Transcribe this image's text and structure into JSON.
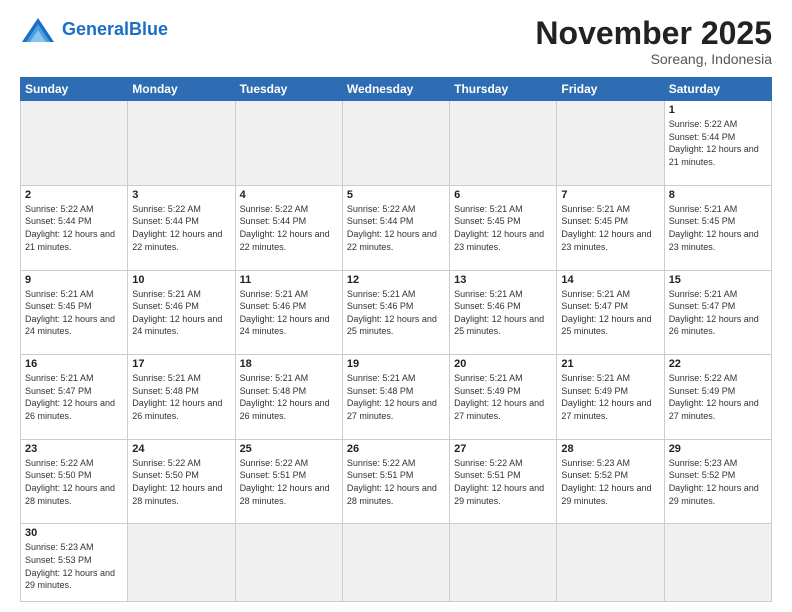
{
  "logo": {
    "general": "General",
    "blue": "Blue"
  },
  "header": {
    "month": "November 2025",
    "location": "Soreang, Indonesia"
  },
  "days_of_week": [
    "Sunday",
    "Monday",
    "Tuesday",
    "Wednesday",
    "Thursday",
    "Friday",
    "Saturday"
  ],
  "weeks": [
    [
      {
        "day": "",
        "info": ""
      },
      {
        "day": "",
        "info": ""
      },
      {
        "day": "",
        "info": ""
      },
      {
        "day": "",
        "info": ""
      },
      {
        "day": "",
        "info": ""
      },
      {
        "day": "",
        "info": ""
      },
      {
        "day": "1",
        "info": "Sunrise: 5:22 AM\nSunset: 5:44 PM\nDaylight: 12 hours and 21 minutes."
      }
    ],
    [
      {
        "day": "2",
        "info": "Sunrise: 5:22 AM\nSunset: 5:44 PM\nDaylight: 12 hours and 21 minutes."
      },
      {
        "day": "3",
        "info": "Sunrise: 5:22 AM\nSunset: 5:44 PM\nDaylight: 12 hours and 22 minutes."
      },
      {
        "day": "4",
        "info": "Sunrise: 5:22 AM\nSunset: 5:44 PM\nDaylight: 12 hours and 22 minutes."
      },
      {
        "day": "5",
        "info": "Sunrise: 5:22 AM\nSunset: 5:44 PM\nDaylight: 12 hours and 22 minutes."
      },
      {
        "day": "6",
        "info": "Sunrise: 5:21 AM\nSunset: 5:45 PM\nDaylight: 12 hours and 23 minutes."
      },
      {
        "day": "7",
        "info": "Sunrise: 5:21 AM\nSunset: 5:45 PM\nDaylight: 12 hours and 23 minutes."
      },
      {
        "day": "8",
        "info": "Sunrise: 5:21 AM\nSunset: 5:45 PM\nDaylight: 12 hours and 23 minutes."
      }
    ],
    [
      {
        "day": "9",
        "info": "Sunrise: 5:21 AM\nSunset: 5:45 PM\nDaylight: 12 hours and 24 minutes."
      },
      {
        "day": "10",
        "info": "Sunrise: 5:21 AM\nSunset: 5:46 PM\nDaylight: 12 hours and 24 minutes."
      },
      {
        "day": "11",
        "info": "Sunrise: 5:21 AM\nSunset: 5:46 PM\nDaylight: 12 hours and 24 minutes."
      },
      {
        "day": "12",
        "info": "Sunrise: 5:21 AM\nSunset: 5:46 PM\nDaylight: 12 hours and 25 minutes."
      },
      {
        "day": "13",
        "info": "Sunrise: 5:21 AM\nSunset: 5:46 PM\nDaylight: 12 hours and 25 minutes."
      },
      {
        "day": "14",
        "info": "Sunrise: 5:21 AM\nSunset: 5:47 PM\nDaylight: 12 hours and 25 minutes."
      },
      {
        "day": "15",
        "info": "Sunrise: 5:21 AM\nSunset: 5:47 PM\nDaylight: 12 hours and 26 minutes."
      }
    ],
    [
      {
        "day": "16",
        "info": "Sunrise: 5:21 AM\nSunset: 5:47 PM\nDaylight: 12 hours and 26 minutes."
      },
      {
        "day": "17",
        "info": "Sunrise: 5:21 AM\nSunset: 5:48 PM\nDaylight: 12 hours and 26 minutes."
      },
      {
        "day": "18",
        "info": "Sunrise: 5:21 AM\nSunset: 5:48 PM\nDaylight: 12 hours and 26 minutes."
      },
      {
        "day": "19",
        "info": "Sunrise: 5:21 AM\nSunset: 5:48 PM\nDaylight: 12 hours and 27 minutes."
      },
      {
        "day": "20",
        "info": "Sunrise: 5:21 AM\nSunset: 5:49 PM\nDaylight: 12 hours and 27 minutes."
      },
      {
        "day": "21",
        "info": "Sunrise: 5:21 AM\nSunset: 5:49 PM\nDaylight: 12 hours and 27 minutes."
      },
      {
        "day": "22",
        "info": "Sunrise: 5:22 AM\nSunset: 5:49 PM\nDaylight: 12 hours and 27 minutes."
      }
    ],
    [
      {
        "day": "23",
        "info": "Sunrise: 5:22 AM\nSunset: 5:50 PM\nDaylight: 12 hours and 28 minutes."
      },
      {
        "day": "24",
        "info": "Sunrise: 5:22 AM\nSunset: 5:50 PM\nDaylight: 12 hours and 28 minutes."
      },
      {
        "day": "25",
        "info": "Sunrise: 5:22 AM\nSunset: 5:51 PM\nDaylight: 12 hours and 28 minutes."
      },
      {
        "day": "26",
        "info": "Sunrise: 5:22 AM\nSunset: 5:51 PM\nDaylight: 12 hours and 28 minutes."
      },
      {
        "day": "27",
        "info": "Sunrise: 5:22 AM\nSunset: 5:51 PM\nDaylight: 12 hours and 29 minutes."
      },
      {
        "day": "28",
        "info": "Sunrise: 5:23 AM\nSunset: 5:52 PM\nDaylight: 12 hours and 29 minutes."
      },
      {
        "day": "29",
        "info": "Sunrise: 5:23 AM\nSunset: 5:52 PM\nDaylight: 12 hours and 29 minutes."
      }
    ],
    [
      {
        "day": "30",
        "info": "Sunrise: 5:23 AM\nSunset: 5:53 PM\nDaylight: 12 hours and 29 minutes."
      },
      {
        "day": "",
        "info": ""
      },
      {
        "day": "",
        "info": ""
      },
      {
        "day": "",
        "info": ""
      },
      {
        "day": "",
        "info": ""
      },
      {
        "day": "",
        "info": ""
      },
      {
        "day": "",
        "info": ""
      }
    ]
  ]
}
